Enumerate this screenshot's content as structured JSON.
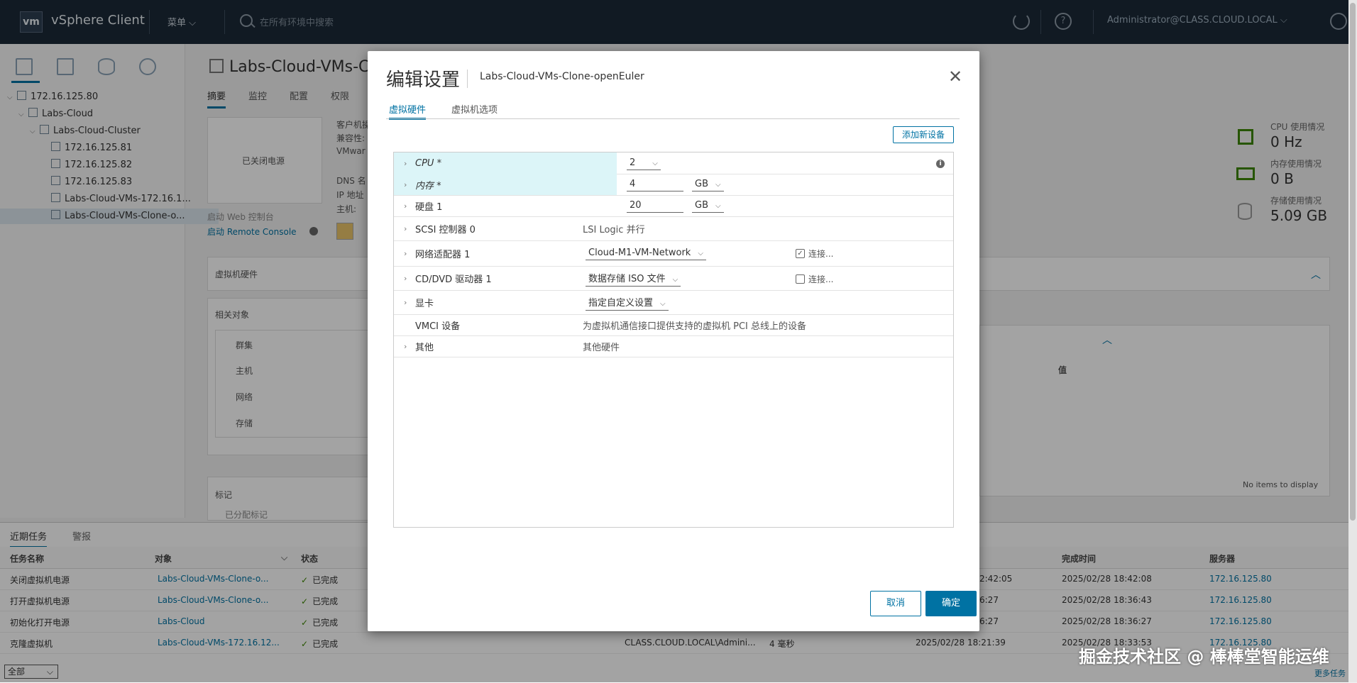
{
  "header": {
    "logo": "vm",
    "app_title": "vSphere Client",
    "menu_label": "菜单",
    "search_placeholder": "在所有环境中搜索",
    "user": "Administrator@CLASS.CLOUD.LOCAL"
  },
  "tree": [
    {
      "label": "172.16.125.80",
      "indent": 0
    },
    {
      "label": "Labs-Cloud",
      "indent": 1
    },
    {
      "label": "Labs-Cloud-Cluster",
      "indent": 2
    },
    {
      "label": "172.16.125.81",
      "indent": 3
    },
    {
      "label": "172.16.125.82",
      "indent": 3
    },
    {
      "label": "172.16.125.83",
      "indent": 3
    },
    {
      "label": "Labs-Cloud-VMs-172.16.1...",
      "indent": 3
    },
    {
      "label": "Labs-Cloud-VMs-Clone-o...",
      "indent": 3,
      "selected": true
    }
  ],
  "background": {
    "vm_title": "Labs-Cloud-VMs-C",
    "tabs": [
      "摘要",
      "监控",
      "配置",
      "权限"
    ],
    "power_state": "已关闭电源",
    "guest_labels": [
      "客户机操",
      "兼容性:",
      "VMwar",
      "DNS 名",
      "IP 地址",
      "主机:"
    ],
    "web_console": "启动 Web 控制台",
    "remote_console": "启动 Remote Console",
    "hw_card_title": "虚拟机硬件",
    "related_title": "相关对象",
    "related_items": [
      "群集",
      "主机",
      "网络",
      "存储"
    ],
    "tags_title": "标记",
    "tags_sub": "已分配标记",
    "cpu_usage_label": "CPU 使用情况",
    "cpu_usage_value": "0 Hz",
    "mem_usage_label": "内存使用情况",
    "mem_usage_value": "0 B",
    "storage_usage_label": "存储使用情况",
    "storage_usage_value": "5.09 GB",
    "value_col": "值",
    "no_items": "No items to display"
  },
  "tasks": {
    "tab_recent": "近期任务",
    "tab_alarms": "警报",
    "headers": [
      "任务名称",
      "对象",
      "状态",
      "完成时间",
      "服务器"
    ],
    "rows": [
      {
        "name": "关闭虚拟机电源",
        "object": "Labs-Cloud-VMs-Clone-o...",
        "status": "已完成",
        "mid": "2:42:05",
        "done": "2025/02/28 18:42:08",
        "server": "172.16.125.80"
      },
      {
        "name": "打开虚拟机电源",
        "object": "Labs-Cloud-VMs-Clone-o...",
        "status": "已完成",
        "mid": "6:27",
        "done": "2025/02/28 18:36:43",
        "server": "172.16.125.80"
      },
      {
        "name": "初始化打开电源",
        "object": "Labs-Cloud",
        "status": "已完成",
        "mid": "6:27",
        "done": "2025/02/28 18:36:27",
        "server": "172.16.125.80"
      },
      {
        "name": "克隆虚拟机",
        "object": "Labs-Cloud-VMs-172.16.12...",
        "status": "已完成",
        "initiator": "CLASS.CLOUD.LOCAL\\Admini...",
        "queued": "4 毫秒",
        "start": "2025/02/28 18:21:39",
        "done": "2025/02/28 18:33:53",
        "server": "172.16.125.80"
      }
    ],
    "filter": "全部",
    "more_tasks": "更多任务"
  },
  "dialog": {
    "title": "编辑设置",
    "vm_name": "Labs-Cloud-VMs-Clone-openEuler",
    "tabs": [
      "虚拟硬件",
      "虚拟机选项"
    ],
    "add_device": "添加新设备",
    "rows": {
      "cpu": {
        "label": "CPU *",
        "value": "2"
      },
      "memory": {
        "label": "内存 *",
        "value": "4",
        "unit": "GB"
      },
      "disk": {
        "label": "硬盘 1",
        "value": "20",
        "unit": "GB"
      },
      "scsi": {
        "label": "SCSI 控制器 0",
        "value": "LSI Logic 并行"
      },
      "nic": {
        "label": "网络适配器 1",
        "value": "Cloud-M1-VM-Network",
        "connect": "连接...",
        "checked": true
      },
      "cdrom": {
        "label": "CD/DVD 驱动器 1",
        "value": "数据存储 ISO 文件",
        "connect": "连接...",
        "checked": false
      },
      "video": {
        "label": "显卡",
        "value": "指定自定义设置"
      },
      "vmci": {
        "label": "VMCI 设备",
        "value": "为虚拟机通信接口提供支持的虚拟机 PCI 总线上的设备"
      },
      "other": {
        "label": "其他",
        "value": "其他硬件"
      }
    },
    "cancel": "取消",
    "ok": "确定"
  },
  "watermark": "掘金技术社区 @ 棒棒堂智能运维"
}
